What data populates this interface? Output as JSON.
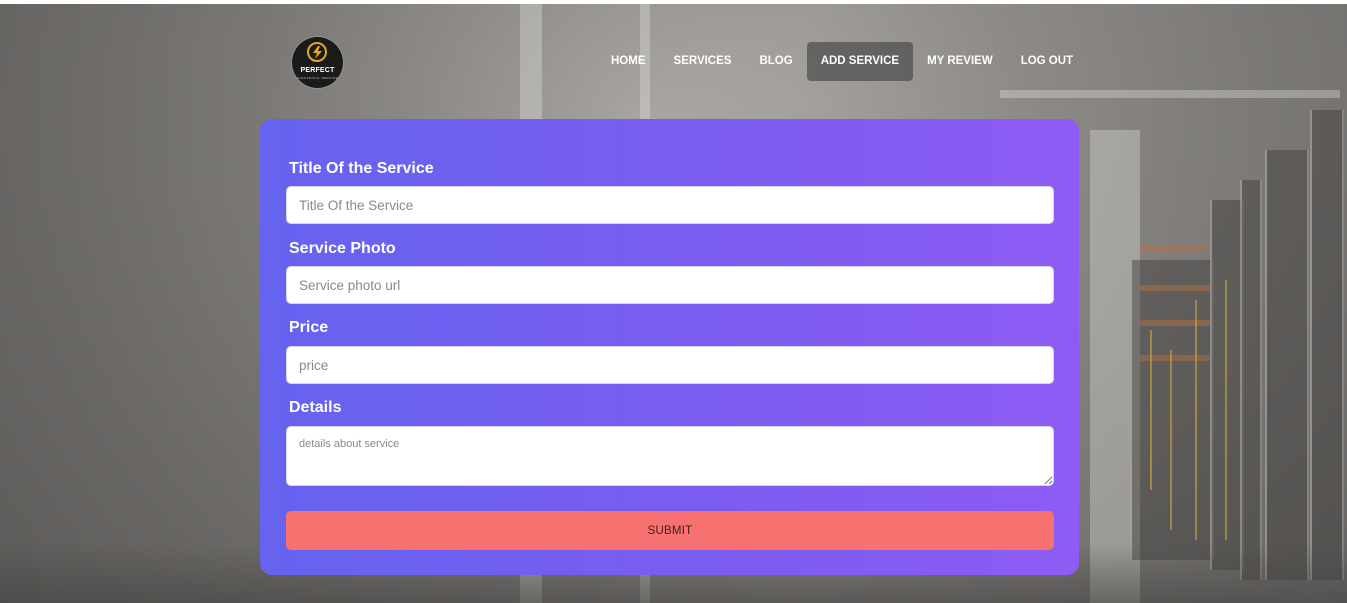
{
  "brand": {
    "logo_text": "PERFECT",
    "logo_subtext": "ELECTRICAL SERVICE"
  },
  "nav": {
    "items": [
      {
        "label": "HOME"
      },
      {
        "label": "SERVICES"
      },
      {
        "label": "BLOG"
      },
      {
        "label": "ADD SERVICE",
        "active": true
      },
      {
        "label": "MY REVIEW"
      },
      {
        "label": "LOG OUT"
      }
    ]
  },
  "form": {
    "title_label": "Title Of the Service",
    "title_placeholder": "Title Of the Service",
    "photo_label": "Service Photo",
    "photo_placeholder": "Service photo url",
    "price_label": "Price",
    "price_placeholder": "price",
    "details_label": "Details",
    "details_placeholder": "details about service",
    "submit_label": "SUBMIT"
  },
  "colors": {
    "card_gradient_start": "#6563ef",
    "card_gradient_end": "#8d5cf4",
    "submit_bg": "#f87171",
    "logo_accent": "#e5a623"
  }
}
